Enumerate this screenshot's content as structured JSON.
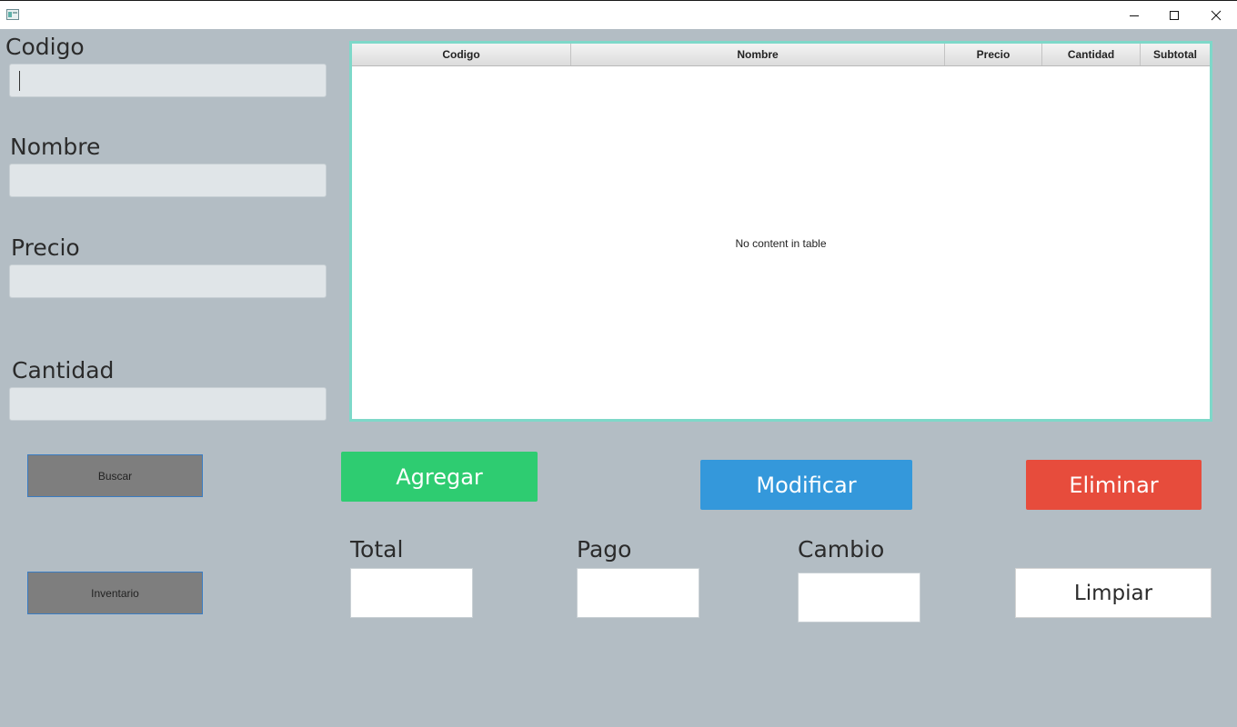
{
  "window": {
    "minimize_glyph": "─",
    "maximize_glyph": "☐",
    "close_glyph": "✕"
  },
  "form": {
    "codigo_label": "Codigo",
    "codigo_value": "",
    "nombre_label": "Nombre",
    "nombre_value": "",
    "precio_label": "Precio",
    "precio_value": "",
    "cantidad_label": "Cantidad",
    "cantidad_value": ""
  },
  "table": {
    "columns": [
      "Codigo",
      "Nombre",
      "Precio",
      "Cantidad",
      "Subtotal"
    ],
    "rows": [],
    "empty_message": "No content in table"
  },
  "buttons": {
    "buscar": "Buscar",
    "inventario": "Inventario",
    "agregar": "Agregar",
    "modificar": "Modificar",
    "eliminar": "Eliminar",
    "limpiar": "Limpiar"
  },
  "totals": {
    "total_label": "Total",
    "total_value": "",
    "pago_label": "Pago",
    "pago_value": "",
    "cambio_label": "Cambio",
    "cambio_value": ""
  },
  "colors": {
    "background": "#b3bdc4",
    "agregar": "#2ecc71",
    "modificar": "#3498db",
    "eliminar": "#e74c3c",
    "table_border": "#7ed8c9"
  }
}
